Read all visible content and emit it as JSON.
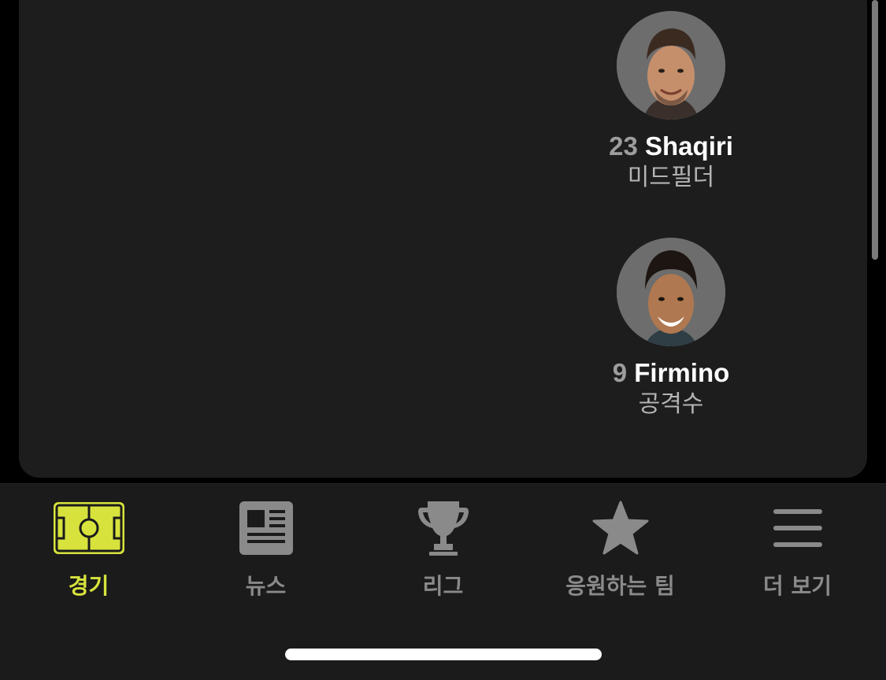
{
  "lineup": {
    "players": [
      {
        "number": "23",
        "name": "Shaqiri",
        "position": "미드필더"
      },
      {
        "number": "9",
        "name": "Firmino",
        "position": "공격수"
      }
    ]
  },
  "tabbar": {
    "tabs": [
      {
        "label": "경기",
        "icon": "soccer-field-icon",
        "active": true
      },
      {
        "label": "뉴스",
        "icon": "newspaper-icon",
        "active": false
      },
      {
        "label": "리그",
        "icon": "trophy-icon",
        "active": false
      },
      {
        "label": "응원하는 팀",
        "icon": "star-icon",
        "active": false
      },
      {
        "label": "더 보기",
        "icon": "menu-icon",
        "active": false
      }
    ]
  },
  "colors": {
    "accent": "#d7e33c",
    "inactive": "#8a8a8a",
    "card_bg": "#1d1d1d"
  }
}
